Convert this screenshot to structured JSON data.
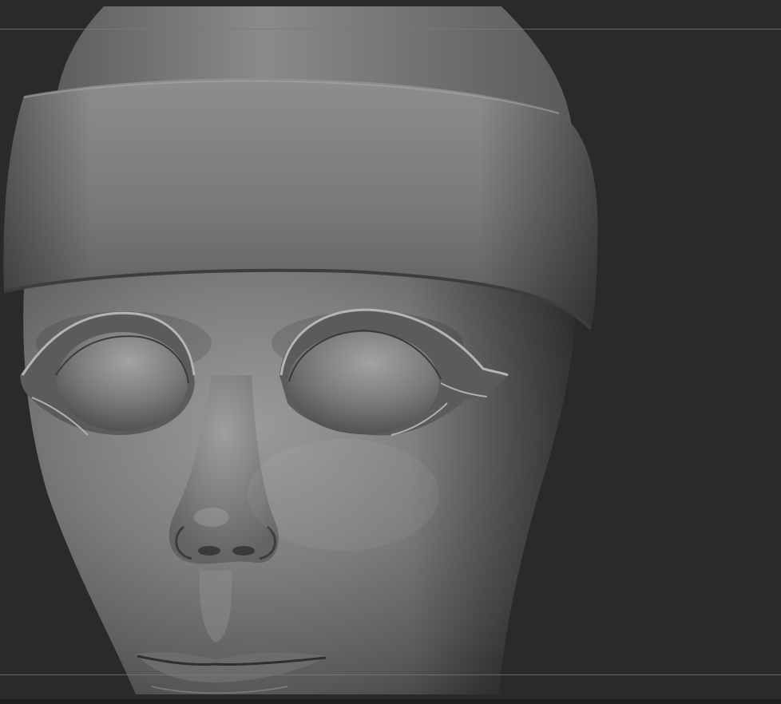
{
  "viewport": {
    "background_color": "#2a2a2a",
    "guide_color": "#7a7a7a",
    "material_color": "#8a8a8a",
    "subject": "sculpted-head-model"
  }
}
